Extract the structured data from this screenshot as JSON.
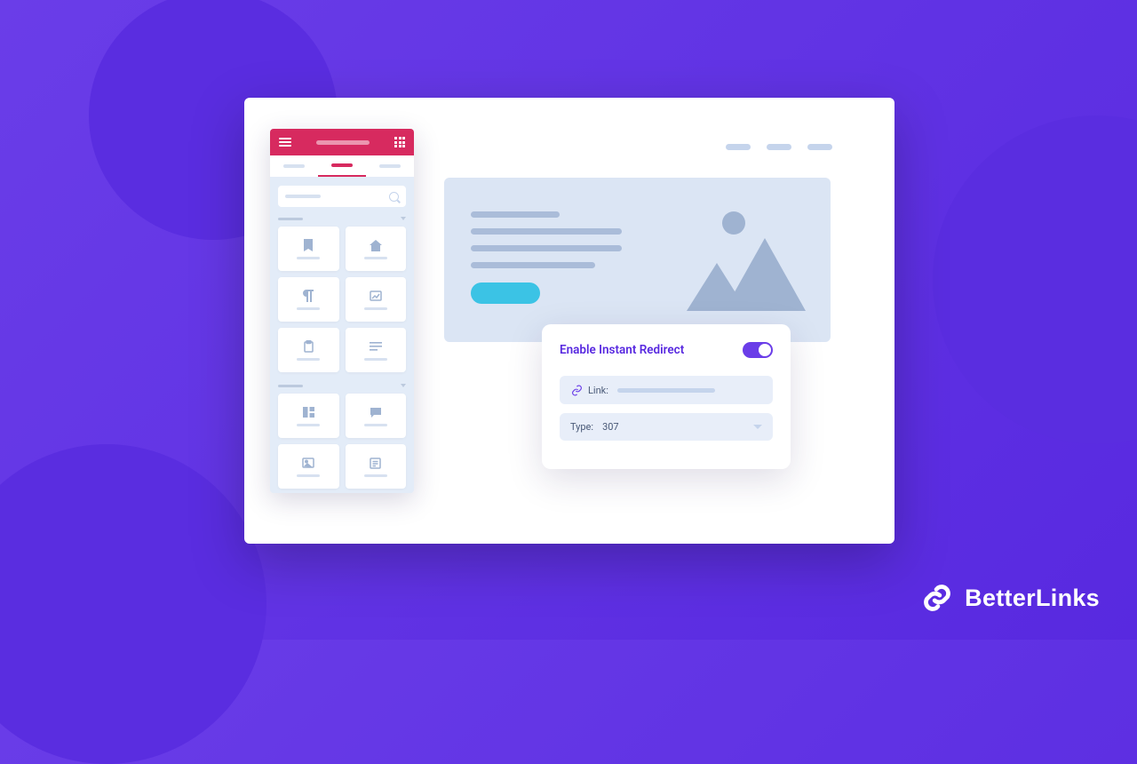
{
  "brand": {
    "name": "BetterLinks"
  },
  "popup": {
    "title": "Enable Instant Redirect",
    "toggle_on": true,
    "link_label": "Link:",
    "type_label": "Type:",
    "type_value": "307"
  },
  "sidebar": {
    "header_icon": "menu",
    "search_placeholder": "",
    "tabs": [
      "tab1",
      "tab2",
      "tab3"
    ],
    "active_tab": 1,
    "sections": [
      {
        "name": "section-1",
        "widgets": [
          {
            "icon": "bookmark-icon"
          },
          {
            "icon": "home-icon"
          },
          {
            "icon": "paragraph-icon"
          },
          {
            "icon": "image-frame-icon"
          },
          {
            "icon": "clipboard-icon"
          },
          {
            "icon": "text-lines-icon"
          }
        ]
      },
      {
        "name": "section-2",
        "widgets": [
          {
            "icon": "columns-icon"
          },
          {
            "icon": "chat-icon"
          },
          {
            "icon": "picture-icon"
          },
          {
            "icon": "list-box-icon"
          }
        ]
      }
    ]
  },
  "nav": {
    "items": [
      "nav1",
      "nav2",
      "nav3"
    ]
  },
  "colors": {
    "primary": "#6a3de8",
    "accent_pink": "#d72a5f",
    "accent_cyan": "#3bc3e5",
    "panel_blue": "#dbe5f4"
  }
}
